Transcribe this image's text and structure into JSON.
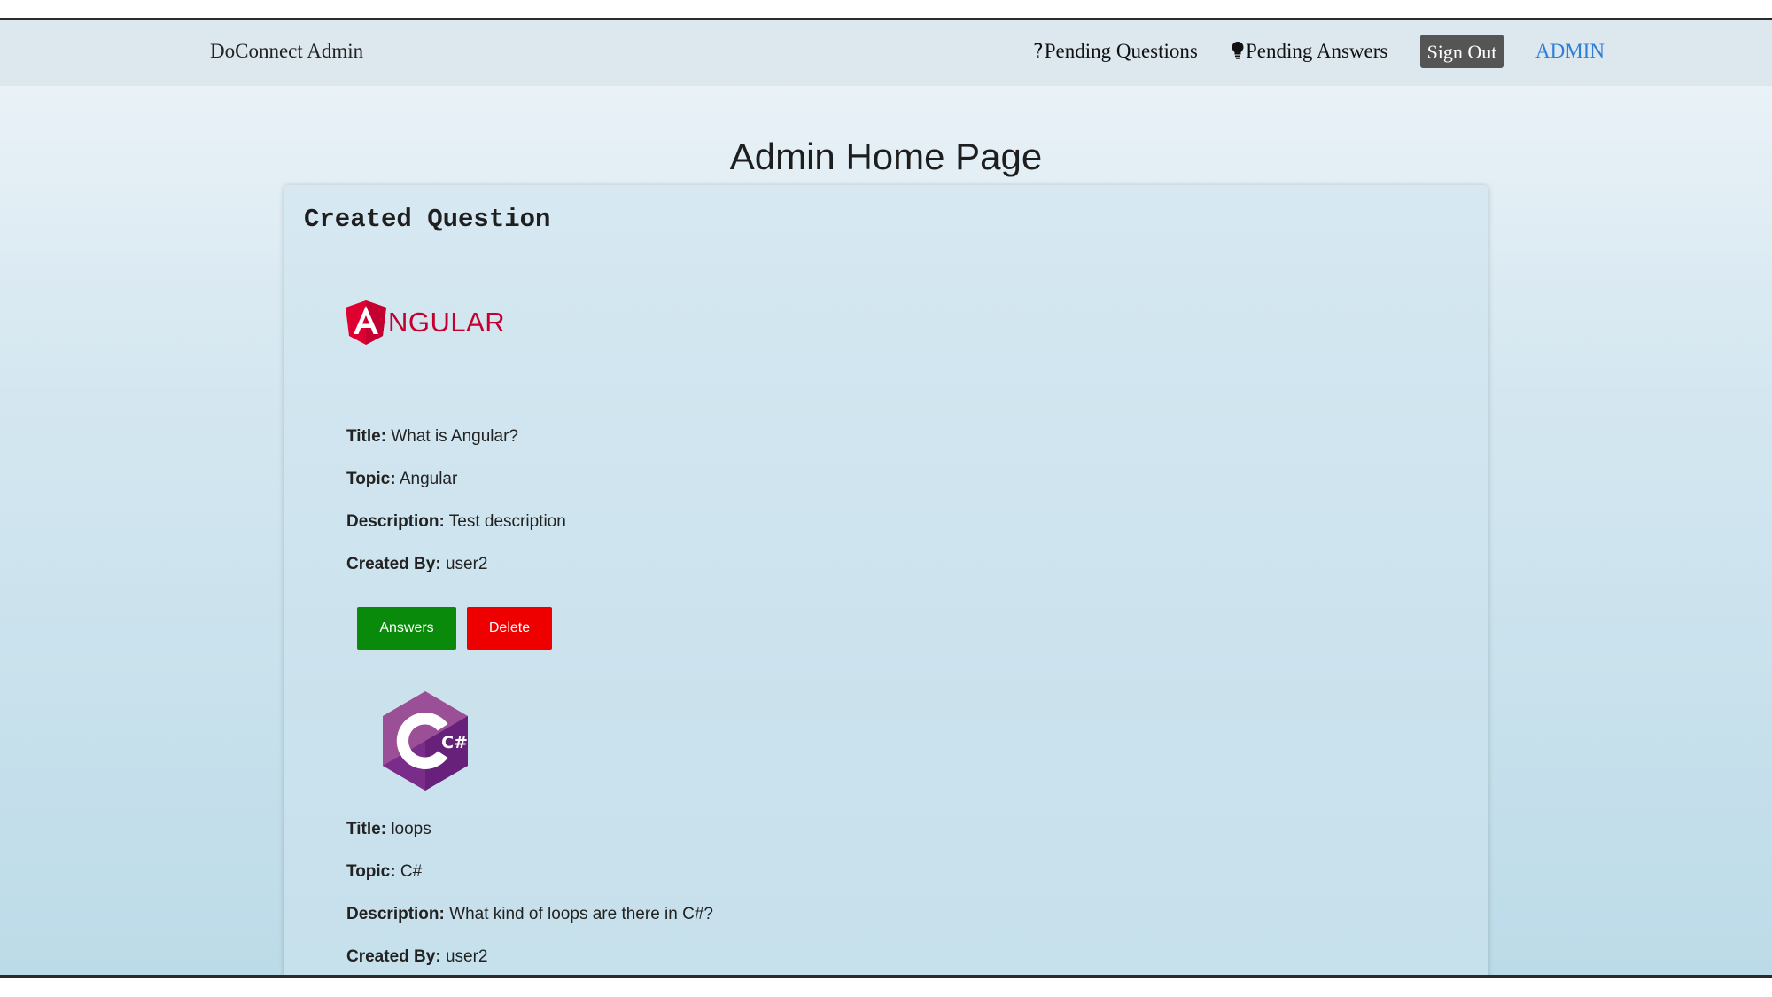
{
  "navbar": {
    "brand": "DoConnect Admin",
    "pending_questions": "Pending Questions",
    "pending_answers": "Pending Answers",
    "sign_out": "Sign Out",
    "user": "ADMIN",
    "icons": [
      "question-mark-icon",
      "lightbulb-icon"
    ]
  },
  "page": {
    "title": "Admin Home Page"
  },
  "card": {
    "heading": "Created Question"
  },
  "labels": {
    "title": "Title:",
    "topic": "Topic:",
    "description": "Description:",
    "created_by": "Created By:"
  },
  "questions": [
    {
      "logo_text": "NGULAR",
      "title": "What is Angular?",
      "topic": "Angular",
      "description": "Test description",
      "created_by": "user2",
      "answers_label": "Answers",
      "delete_label": "Delete"
    },
    {
      "logo_text": "C#",
      "title": "loops",
      "topic": "C#",
      "description": "What kind of loops are there in C#?",
      "created_by": "user2"
    }
  ],
  "colors": {
    "answers_button": "#0a8a0a",
    "delete_button": "#ee0000",
    "admin_link": "#2f7fd6",
    "angular_red": "#c3002f",
    "csharp_purple": "#68217a"
  }
}
